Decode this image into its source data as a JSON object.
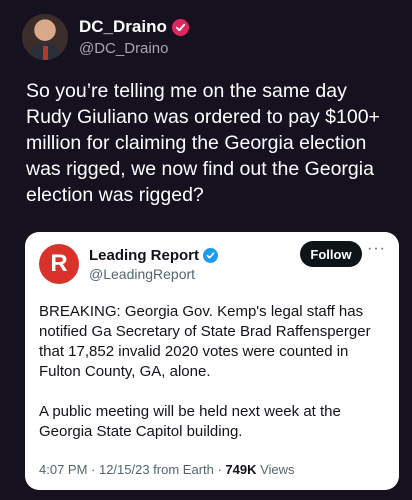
{
  "author": {
    "display_name": "DC_Draino",
    "handle": "@DC_Draino",
    "verified_color": "#e0245e",
    "avatar_icon": "person-avatar"
  },
  "tweet": {
    "text": "So you’re telling me on the same day Rudy Giuliano was ordered to pay $100+ million for claiming the Georgia election was rigged, we now find out the Georgia election was rigged?"
  },
  "quoted": {
    "display_name": "Leading Report",
    "handle": "@LeadingReport",
    "logo_letter": "R",
    "logo_color": "#d8322a",
    "verified_color": "#1d9bf0",
    "follow_label": "Follow",
    "more_label": "···",
    "paragraphs": [
      "BREAKING: Georgia Gov. Kemp's legal staff has notified Ga Secretary of State Brad Raffensperger that 17,852 invalid 2020 votes were counted in Fulton County, GA, alone.",
      "A public meeting will be held next week at the Georgia State Capitol building."
    ],
    "meta_prefix": "4:07 PM · 12/15/23 from Earth · ",
    "views_count": "749K",
    "views_label": " Views"
  }
}
